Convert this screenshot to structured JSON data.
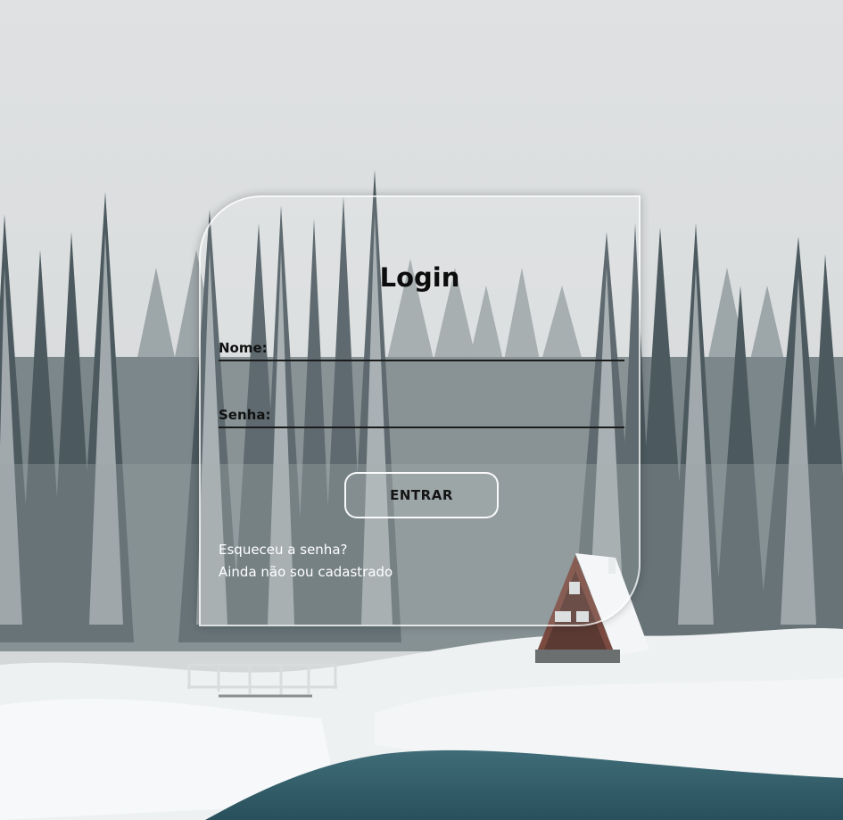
{
  "login": {
    "title": "Login",
    "name_label": "Nome:",
    "name_value": "",
    "password_label": "Senha:",
    "password_value": "",
    "submit_label": "ENTRAR",
    "forgot_password_link": "Esqueceu a senha?",
    "register_link": "Ainda não sou cadastrado"
  },
  "background": {
    "scene": "snowy-forest-cabin",
    "sky_color": "#dfe1e2",
    "tree_color": "#4c5a5f",
    "snow_color": "#f2f4f5",
    "water_color": "#3f6c78"
  },
  "icons": {
    "cabin": "cabin-icon",
    "bridge": "bridge-icon"
  }
}
